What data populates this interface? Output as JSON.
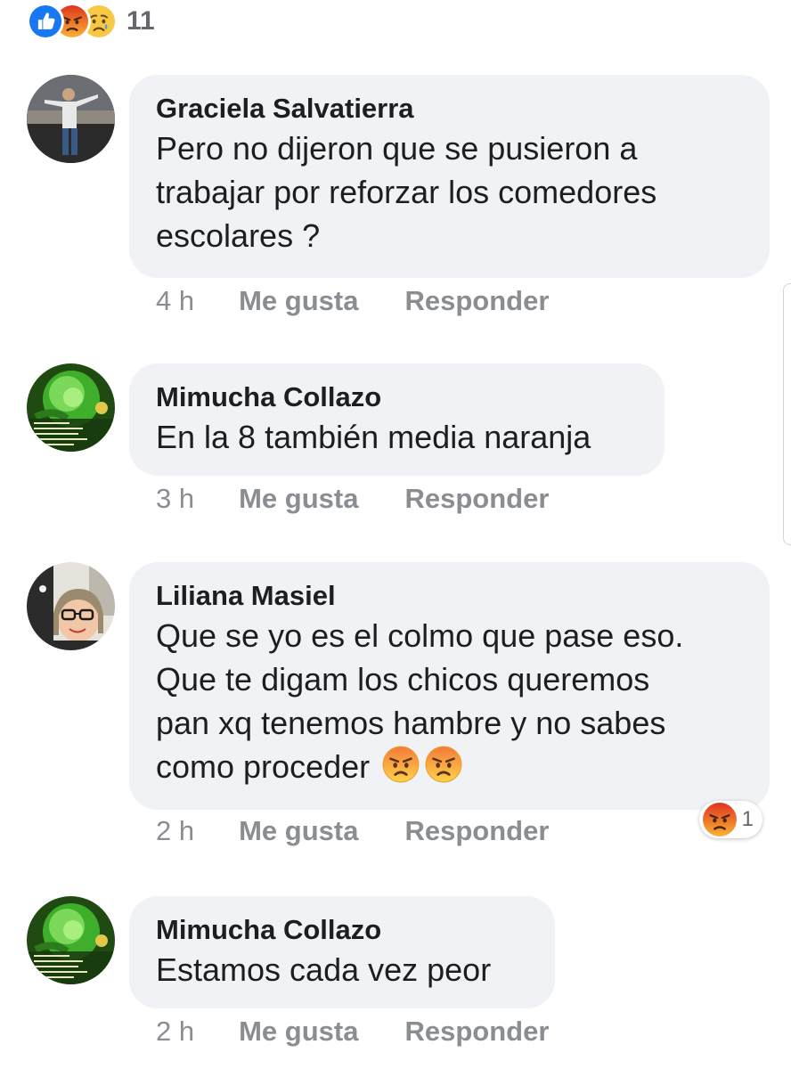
{
  "reactions_summary": {
    "icons": [
      "like-icon",
      "angry-icon",
      "sad-icon"
    ],
    "count": "11"
  },
  "comments": [
    {
      "author": "Graciela Salvatierra",
      "lines": [
        "Pero no dijeron que se pusieron a",
        "trabajar por reforzar los comedores",
        "escolares ?"
      ],
      "time": "4 h",
      "like_label": "Me gusta",
      "reply_label": "Responder"
    },
    {
      "author": "Mimucha Collazo",
      "lines": [
        "En la 8 también media naranja"
      ],
      "time": "3 h",
      "like_label": "Me gusta",
      "reply_label": "Responder"
    },
    {
      "author": "Liliana Masiel",
      "lines": [
        "Que se yo es el colmo que pase eso.",
        "Que te digam los chicos queremos",
        "pan xq tenemos hambre y no sabes",
        "como proceder"
      ],
      "trailing_emojis": [
        "angry-emoji",
        "angry-emoji"
      ],
      "time": "2 h",
      "like_label": "Me gusta",
      "reply_label": "Responder",
      "reaction": {
        "icon": "angry-icon",
        "count": "1"
      }
    },
    {
      "author": "Mimucha Collazo",
      "lines": [
        "Estamos cada vez peor"
      ],
      "time": "2 h",
      "like_label": "Me gusta",
      "reply_label": "Responder"
    }
  ],
  "colors": {
    "bubble": "#f0f2f5",
    "action_text": "#8a8d91",
    "like_blue": "#1877f2",
    "angry_orange": "#f0641e"
  }
}
